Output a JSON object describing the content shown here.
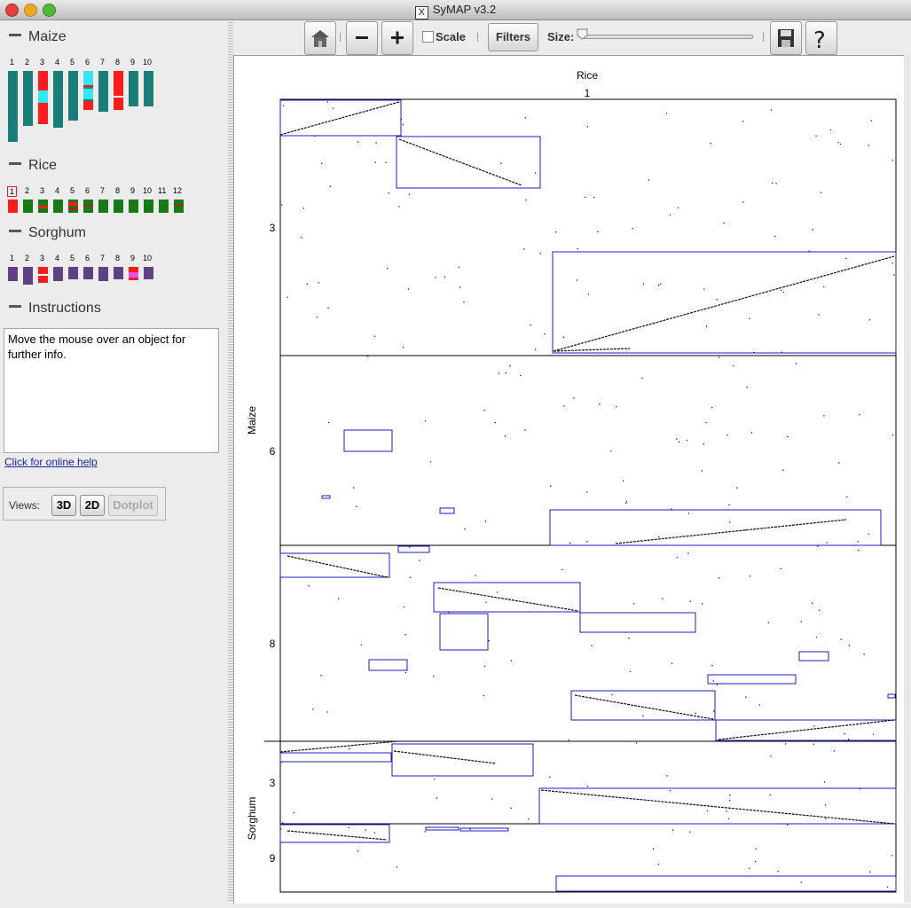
{
  "window": {
    "title": "SyMAP v3.2",
    "x_badge": "X"
  },
  "species": [
    {
      "name": "Maize",
      "chromosomes": [
        "1",
        "2",
        "3",
        "4",
        "5",
        "6",
        "7",
        "8",
        "9",
        "10"
      ]
    },
    {
      "name": "Rice",
      "chromosomes": [
        "1",
        "2",
        "3",
        "4",
        "5",
        "6",
        "7",
        "8",
        "9",
        "10",
        "11",
        "12"
      ],
      "selected": "1"
    },
    {
      "name": "Sorghum",
      "chromosomes": [
        "1",
        "2",
        "3",
        "4",
        "5",
        "6",
        "7",
        "8",
        "9",
        "10"
      ]
    }
  ],
  "instructions": {
    "title": "Instructions",
    "text": "Move the mouse over an object for further info."
  },
  "help_link": "Click for online help",
  "views": {
    "label": "Views:",
    "options": [
      "3D",
      "2D",
      "Dotplot"
    ],
    "active": "Dotplot"
  },
  "toolbar": {
    "home": "home-icon",
    "zoom_out": "minus-icon",
    "zoom_in": "plus-icon",
    "scale_label": "Scale",
    "scale_checked": false,
    "filters_label": "Filters",
    "size_label": "Size:",
    "size_value": 0,
    "save": "save-icon",
    "help": "help-icon"
  },
  "colors": {
    "maize": "#1b7d78",
    "rice": "#177a17",
    "sorghum": "#5e4283",
    "highlight": "#ff1c1c",
    "cyan": "#33e6f2",
    "pink": "#e64fe8",
    "block": "#1c1cb8"
  },
  "chart_data": {
    "type": "scatter",
    "x_species": "Rice",
    "x_chromosome": "1",
    "y_groups": [
      {
        "species": "Maize",
        "chromosomes": [
          "3",
          "6",
          "8"
        ]
      },
      {
        "species": "Sorghum",
        "chromosomes": [
          "3",
          "9"
        ]
      }
    ]
  }
}
